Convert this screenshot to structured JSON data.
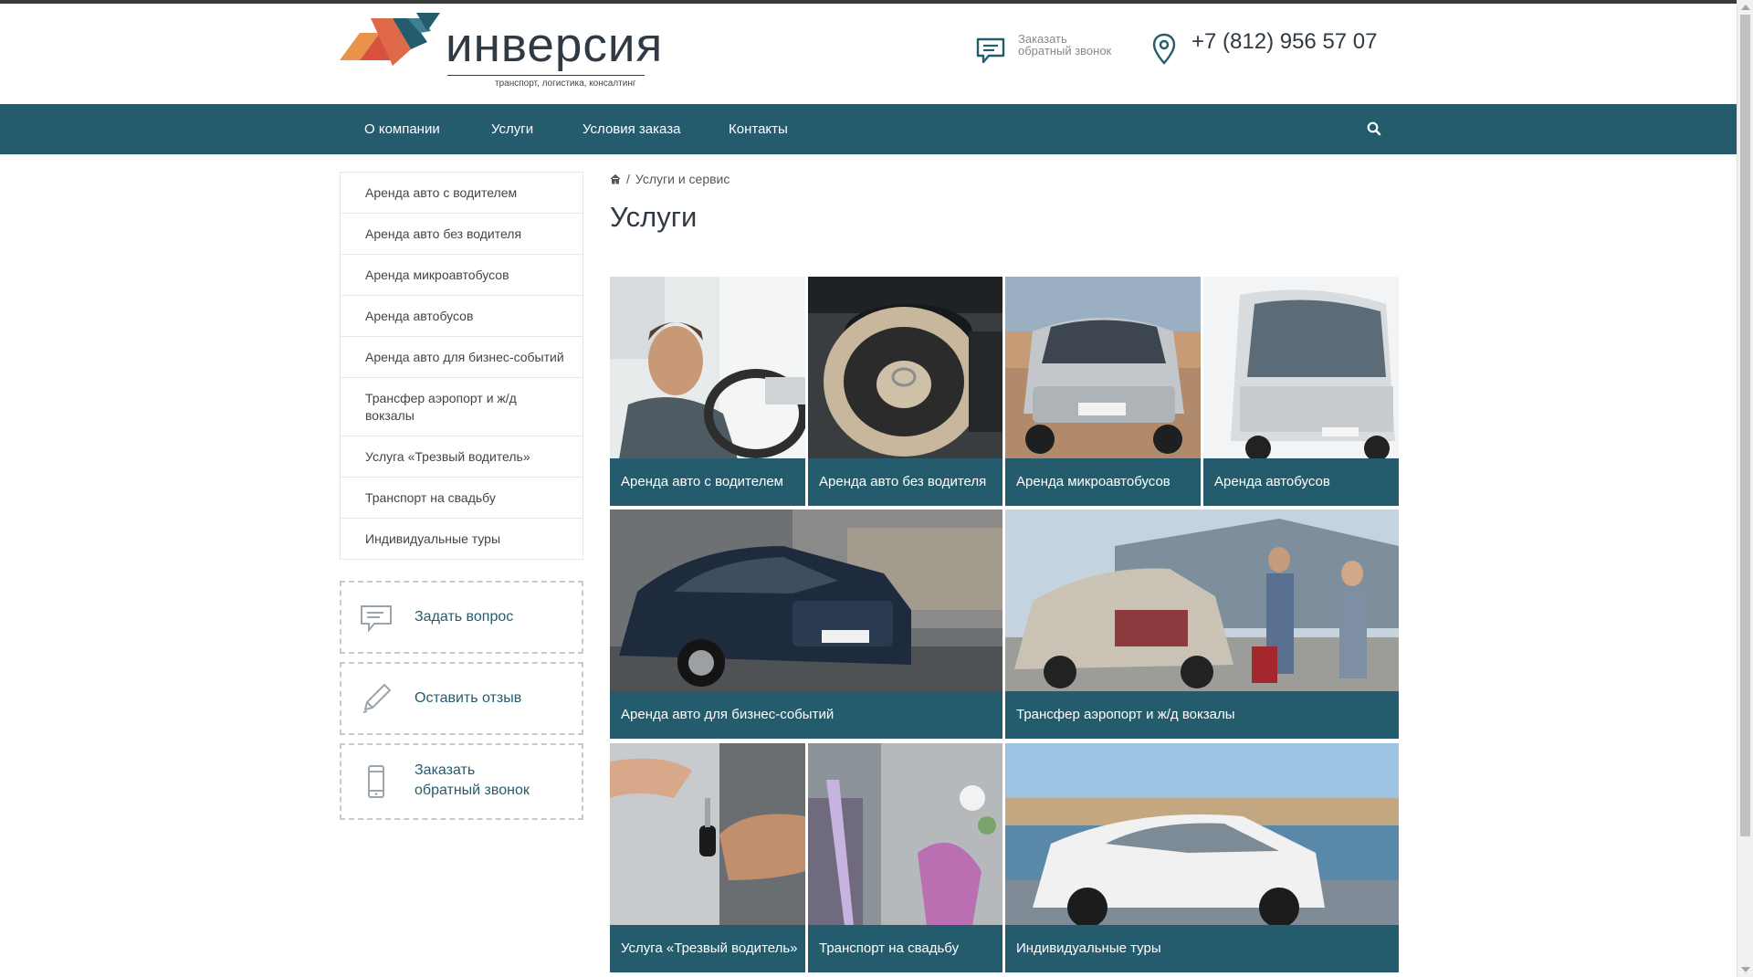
{
  "brand": {
    "name": "инверсия",
    "tagline": "транспорт, логистика, консалтинг",
    "colors": {
      "primary": "#245c6e",
      "logo_red": "#d9503f",
      "logo_orange": "#e9924a",
      "logo_teal": "#245c6e"
    }
  },
  "header": {
    "callback_line1": "Заказать",
    "callback_line2": "обратный звонок",
    "phone": "+7 (812) 956 57 07",
    "callback_icon": "chat-bubble-icon",
    "phone_icon": "map-pin-icon"
  },
  "nav": {
    "items": [
      "О компании",
      "Услуги",
      "Условия заказа",
      "Контакты"
    ],
    "search_icon": "search-icon"
  },
  "sidebar": {
    "items": [
      "Аренда авто с водителем",
      "Аренда авто без водителя",
      "Аренда микроавтобусов",
      "Аренда автобусов",
      "Аренда авто для бизнес-событий",
      "Трансфер аэропорт и ж/д вокзалы",
      "Услуга «Трезвый водитель»",
      "Транспорт на свадьбу",
      "Индивидуальные туры"
    ],
    "actions": [
      {
        "label": "Задать вопрос",
        "icon": "chat-bubble-icon"
      },
      {
        "label": "Оставить отзыв",
        "icon": "pencil-icon"
      },
      {
        "label_line1": "Заказать",
        "label_line2": "обратный звонок",
        "icon": "mobile-phone-icon"
      }
    ]
  },
  "breadcrumb": {
    "home_icon": "home-icon",
    "separator": "/",
    "current": "Услуги и сервис"
  },
  "page": {
    "title": "Услуги"
  },
  "tiles": [
    {
      "label": "Аренда авто с водителем",
      "image": "driver-in-car-photo"
    },
    {
      "label": "Аренда авто без водителя",
      "image": "steering-wheel-photo"
    },
    {
      "label": "Аренда микроавтобусов",
      "image": "minivan-photo"
    },
    {
      "label": "Аренда автобусов",
      "image": "coach-bus-photo"
    },
    {
      "label": "Аренда авто для бизнес-событий",
      "image": "sedan-photo"
    },
    {
      "label": "Трансфер аэропорт и ж/д вокзалы",
      "image": "airport-family-photo"
    },
    {
      "label": "Услуга «Трезвый водитель»",
      "image": "car-keys-handover-photo"
    },
    {
      "label": "Транспорт на свадьбу",
      "image": "wedding-car-photo"
    },
    {
      "label": "Индивидуальные туры",
      "image": "city-car-photo"
    }
  ]
}
